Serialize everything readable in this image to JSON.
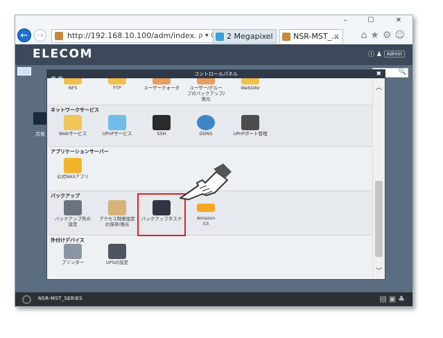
{
  "browser": {
    "window_controls": [
      "–",
      "☐",
      "✕"
    ],
    "url": "http://192.168.10.100/adm/index.",
    "url_tools": "ρ ▾ Ċ",
    "tabs": [
      {
        "label": "2 Megapixel ...",
        "close": ""
      },
      {
        "label": "NSR-MST_...",
        "close": "×"
      }
    ],
    "toolbar_icons": "⌂★⚙☺"
  },
  "app": {
    "logo": "ELECOM",
    "info_icon": "ⓘ",
    "user": "Admin",
    "search_icon": "🔍",
    "footer_name": "NSR-MST_SERIES",
    "footer_icons": "▤▣♣",
    "desktop_share_label": "共有"
  },
  "panel": {
    "title": "コントロールパネル",
    "close": "✖",
    "scroll_up": "︿",
    "scroll_down": "﹀",
    "sections": [
      {
        "title": "",
        "items": [
          "NFS",
          "FTP",
          "ユーザークォータ",
          "ユーザー/グルー\nプのバックアップ/\n復元",
          "WebDAV"
        ]
      },
      {
        "title": "ネットワークサービス",
        "items": [
          "Webサービス",
          "UPnPサービス",
          "SSH",
          "DDNS",
          "UPnPポート管理"
        ]
      },
      {
        "title": "アプリケーションサーバー",
        "items": [
          "公式NASアプリ"
        ]
      },
      {
        "title": "バックアップ",
        "items": [
          "バックアップ先の\n設定",
          "アクセス制限設定\nの保存/復元",
          "バックアップタスク",
          "Amazon\nS3"
        ]
      },
      {
        "title": "外付けデバイス",
        "items": [
          "プリンター",
          "UPSの設定"
        ]
      }
    ]
  },
  "colors": {
    "accent": "#1d6fd1",
    "highlight": "#e02020",
    "header": "#3c495a"
  }
}
